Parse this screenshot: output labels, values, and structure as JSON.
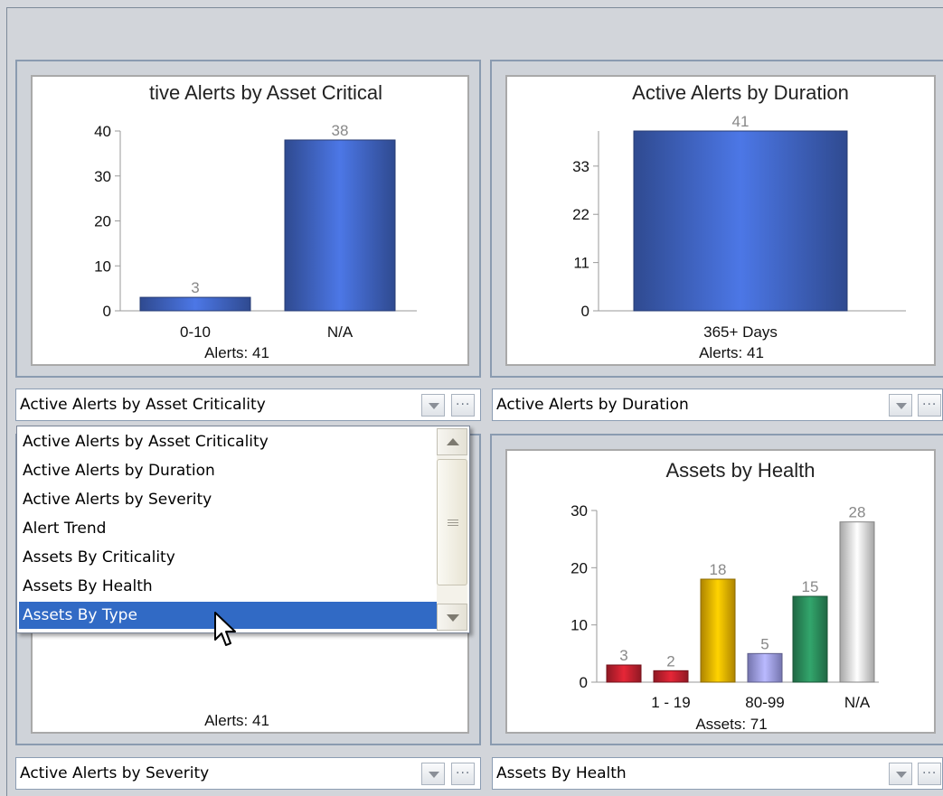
{
  "panels": {
    "top_left": {
      "chart_data": {
        "type": "bar",
        "title": "tive Alerts by Asset Critical",
        "categories": [
          "0-10",
          "N/A"
        ],
        "values": [
          3,
          38
        ],
        "value_labels": [
          "3",
          "38"
        ],
        "yticks": [
          "0",
          "10",
          "20",
          "30",
          "40"
        ],
        "ylim": [
          0,
          40
        ],
        "footer": "Alerts: 41",
        "colors": [
          "#3f63c0"
        ]
      },
      "selector": {
        "value": "Active Alerts by Asset Criticality"
      }
    },
    "top_right": {
      "chart_data": {
        "type": "bar",
        "title": "Active Alerts by Duration",
        "categories": [
          "365+ Days"
        ],
        "values": [
          41
        ],
        "value_labels": [
          "41"
        ],
        "yticks": [
          "0",
          "11",
          "22",
          "33"
        ],
        "ylim": [
          0,
          41
        ],
        "footer": "Alerts: 41",
        "colors": [
          "#3f63c0"
        ]
      },
      "selector": {
        "value": "Active Alerts by Duration"
      }
    },
    "bottom_left": {
      "footer": "Alerts: 41",
      "selector": {
        "value": "Active Alerts by Severity"
      }
    },
    "bottom_right": {
      "chart_data": {
        "type": "bar",
        "title": "Assets by Health",
        "categories": [
          "",
          "1 - 19",
          "",
          "80-99",
          "",
          "N/A"
        ],
        "values": [
          3,
          2,
          18,
          5,
          15,
          28
        ],
        "value_labels": [
          "3",
          "2",
          "18",
          "5",
          "15",
          "28"
        ],
        "yticks": [
          "0",
          "10",
          "20",
          "30"
        ],
        "ylim": [
          0,
          30
        ],
        "footer": "Assets: 71",
        "colors": [
          "#c0202e",
          "#c0202e",
          "#e8b000",
          "#9b9be6",
          "#2a8a5a",
          "#dcdcdc"
        ]
      },
      "selector": {
        "value": "Assets By Health"
      }
    }
  },
  "dropdown": {
    "items": [
      "Active Alerts by Asset Criticality",
      "Active Alerts by Duration",
      "Active Alerts by Severity",
      "Alert Trend",
      "Assets By Criticality",
      "Assets By Health",
      "Assets By Type"
    ],
    "selected_index": 6
  },
  "icons": {
    "combo_arrow": "chevron-down-icon",
    "combo_more": "ellipsis-icon",
    "cursor": "mouse-pointer-icon"
  }
}
